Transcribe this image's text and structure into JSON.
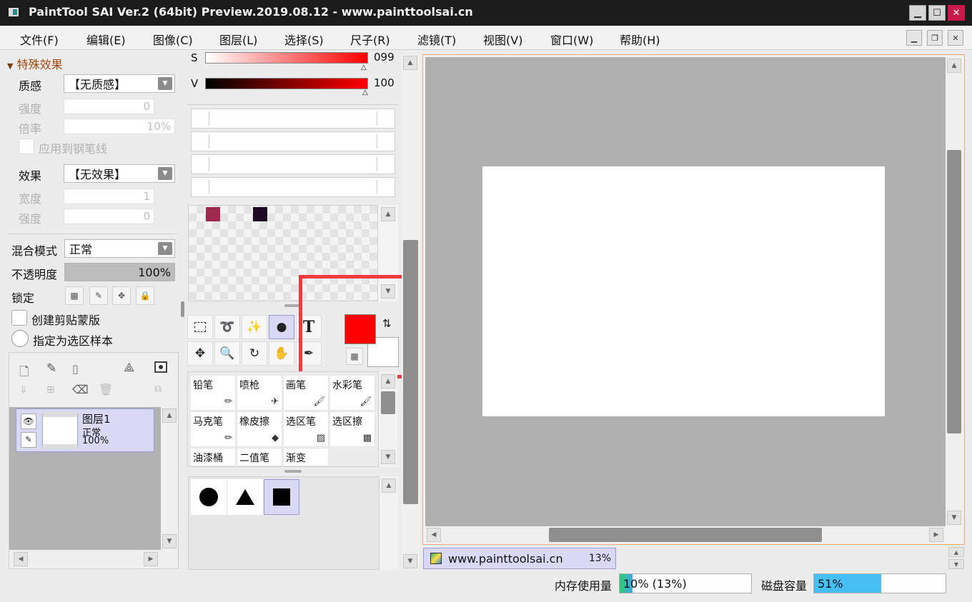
{
  "window": {
    "title": "PaintTool SAI Ver.2 (64bit) Preview.2019.08.12 - www.painttoolsai.cn"
  },
  "menu": [
    "文件(F)",
    "编辑(E)",
    "图像(C)",
    "图层(L)",
    "选择(S)",
    "尺子(R)",
    "滤镜(T)",
    "视图(V)",
    "窗口(W)",
    "帮助(H)"
  ],
  "effects": {
    "header": "特殊效果",
    "texture_label": "质感",
    "texture_value": "【无质感】",
    "strength_label": "强度",
    "strength_value": "0",
    "scale_label": "倍率",
    "scale_value": "10%",
    "apply_pen_label": "应用到钢笔线",
    "effect_label": "效果",
    "effect_value": "【无效果】",
    "width_label": "宽度",
    "width_value": "1",
    "strength2_label": "强度",
    "strength2_value": "0"
  },
  "layer_props": {
    "blend_label": "混合模式",
    "blend_value": "正常",
    "opacity_label": "不透明度",
    "opacity_value": "100%",
    "opacity_fraction": 1.0,
    "lock_label": "锁定",
    "clip_label": "创建剪贴蒙版",
    "select_sample_label": "指定为选区样本"
  },
  "layers": [
    {
      "name": "图层1",
      "mode": "正常",
      "opacity": "100%"
    }
  ],
  "color": {
    "s_label": "S",
    "s_value": "099",
    "v_label": "V",
    "v_value": "100",
    "primary": "#ff0000",
    "secondary": "#ffffff",
    "swatches": [
      "#a02950",
      "#1e0a22"
    ]
  },
  "tools": {
    "text_tool_glyph": "T"
  },
  "brushes": [
    {
      "name": "铅笔",
      "icon": "pencil-icon"
    },
    {
      "name": "喷枪",
      "icon": "airbrush-icon"
    },
    {
      "name": "画笔",
      "icon": "brush-icon"
    },
    {
      "name": "水彩笔",
      "icon": "watercolor-icon"
    },
    {
      "name": "马克笔",
      "icon": "marker-icon"
    },
    {
      "name": "橡皮擦",
      "icon": "eraser-icon"
    },
    {
      "name": "选区笔",
      "icon": "selection-pen-icon"
    },
    {
      "name": "选区擦",
      "icon": "selection-eraser-icon"
    },
    {
      "name": "油漆桶",
      "icon": "bucket-icon"
    },
    {
      "name": "二值笔",
      "icon": "binary-pen-icon"
    },
    {
      "name": "渐变",
      "icon": "gradient-icon"
    }
  ],
  "navigator": {
    "doc_name": "www.painttoolsai.cn",
    "zoom": "13%"
  },
  "status": {
    "memory_label": "内存使用量",
    "memory_value": "10% (13%)",
    "memory_fraction": 0.1,
    "disk_label": "磁盘容量",
    "disk_value": "51%",
    "disk_fraction": 0.51
  },
  "colors": {
    "accent": "#d9d9f5",
    "highlight_box": "#ee3b3b",
    "canvas_bg": "#b0b0b0"
  }
}
